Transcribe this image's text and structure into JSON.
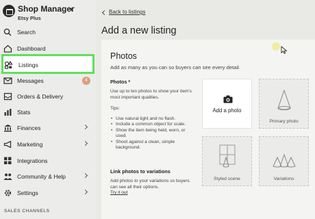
{
  "shop": {
    "title": "Shop Manager",
    "subtitle": "Etsy Plus"
  },
  "sidebar": {
    "items": [
      {
        "label": "Search"
      },
      {
        "label": "Dashboard"
      },
      {
        "label": "Listings",
        "highlighted": true
      },
      {
        "label": "Messages",
        "badge": "4"
      },
      {
        "label": "Orders & Delivery"
      },
      {
        "label": "Stats"
      },
      {
        "label": "Finances",
        "has_chevron": true
      },
      {
        "label": "Marketing",
        "has_chevron": true
      },
      {
        "label": "Integrations"
      },
      {
        "label": "Community & Help",
        "has_chevron": true
      },
      {
        "label": "Settings",
        "has_chevron": true
      }
    ],
    "section_label": "SALES CHANNELS"
  },
  "main": {
    "back_link": "Back to listings",
    "page_title": "Add a new listing",
    "photos_card": {
      "title": "Photos",
      "subtitle": "Add as many as you can so buyers can see every detail.",
      "section_heading": "Photos *",
      "section_desc": "Use up to ten photos to show your item's most important qualities.",
      "tips_label": "Tips:",
      "tips": [
        "Use natural light and no flash.",
        "Include a common object for scale.",
        "Show the item being held, worn, or used.",
        "Shoot against a clean, simple background."
      ],
      "variations_heading": "Link photos to variations",
      "variations_desc": "Add photos to your variations so buyers can see all their options.",
      "try_link": "Try it out",
      "tiles": {
        "add": "Add a photo",
        "primary": "Primary photo",
        "scene": "Styled scene",
        "variations": "Variations"
      }
    }
  },
  "colors": {
    "highlight_border": "#5fe05a",
    "badge": "#d9a07a",
    "cursor_glow": "#f2ec9a"
  },
  "icons": [
    "search-icon",
    "home-icon",
    "shapes-icon",
    "mail-icon",
    "inbox-icon",
    "bar-chart-icon",
    "bank-icon",
    "megaphone-icon",
    "grid-icon",
    "people-icon",
    "gear-icon",
    "camera-icon"
  ]
}
